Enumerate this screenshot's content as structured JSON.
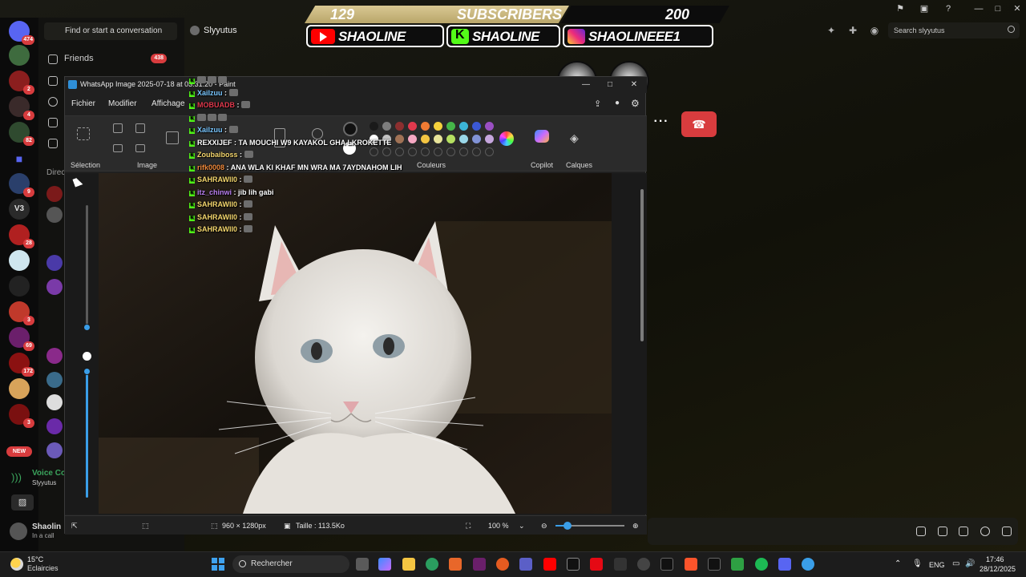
{
  "discord": {
    "dm_search_placeholder": "Find or start a conversation",
    "friends_label": "Friends",
    "friends_count": "438",
    "channel_name": "Slyyutus",
    "search_placeholder": "Search slyyutus",
    "guild_badges": [
      "474",
      "2",
      "4",
      "82",
      "9",
      "28",
      "3",
      "69",
      "172",
      "3"
    ],
    "new_label": "NEW",
    "voice_title": "Voice Co",
    "voice_sub": "Slyyutus",
    "user_name": "Shaolin",
    "user_status": "In a call",
    "v3_label": "V3",
    "direct_label": "Direc",
    "accent_red": "#d83c3e",
    "accent_green": "#3ba55d"
  },
  "paint": {
    "title": "WhatsApp Image 2025-07-18 at 03.31.20 - Paint",
    "menus": [
      "Fichier",
      "Modifier",
      "Affichage"
    ],
    "groups": {
      "selection": "Sélection",
      "image": "Image",
      "colors": "Couleurs",
      "copilot": "Copilot",
      "layers": "Calques"
    },
    "dimensions": "960 × 1280px",
    "size": "Taille : 113.5Ko",
    "zoom": "100 %",
    "palette": [
      "#1a1a1a",
      "#7d7d7d",
      "#8c2f2f",
      "#e0394d",
      "#f07b33",
      "#f5d13c",
      "#45b649",
      "#3cb5d8",
      "#3b58d4",
      "#9a4fc2",
      "#ffffff",
      "#c3c3c3",
      "#a07255",
      "#f6a8c3",
      "#f4c542",
      "#e8e49a",
      "#b5e061",
      "#9ad7e8",
      "#8193d6",
      "#c5a6dd"
    ]
  },
  "overlay": {
    "subscribers_current": "129",
    "subscribers_label": "SUBSCRIBERS",
    "subscribers_goal": "200",
    "youtube_handle": "SHAOLINE",
    "kick_handle": "SHAOLINE",
    "instagram_handle": "SHAOLINEEE1",
    "chat": [
      {
        "user": "",
        "text": "",
        "color": "#ffffff"
      },
      {
        "user": "XaiIzuu",
        "text": "",
        "color": "#7ac7ff"
      },
      {
        "user": "MOBUADB",
        "text": "",
        "color": "#e0394d"
      },
      {
        "user": "",
        "text": "",
        "color": "#e0394d"
      },
      {
        "user": "XaiIzuu",
        "text": "",
        "color": "#7ac7ff"
      },
      {
        "user": "REXXIJEF",
        "text": "TA MOUCHI W9 KAYAKOL GHA LKROKETTE",
        "color": "#ffffff"
      },
      {
        "user": "Zoubaiboss",
        "text": "",
        "color": "#f5d76e"
      },
      {
        "user": "rifk0008",
        "text": "ANA WLA KI KHAF MN WRA MA 7AYDNAHOM LIH",
        "color": "#f08a3c"
      },
      {
        "user": "SAHRAWII0",
        "text": "",
        "color": "#f5d76e"
      },
      {
        "user": "itz_chinwi",
        "text": "jib lih gabi",
        "color": "#b97ff0"
      },
      {
        "user": "SAHRAWII0",
        "text": "",
        "color": "#f5d76e"
      },
      {
        "user": "SAHRAWII0",
        "text": "",
        "color": "#f5d76e"
      },
      {
        "user": "SAHRAWII0",
        "text": "",
        "color": "#f5d76e"
      }
    ]
  },
  "taskbar": {
    "temperature": "15°C",
    "weather": "Eclaircies",
    "search_label": "Rechercher",
    "lang": "ENG",
    "time": "17:46",
    "date": "28/12/2025"
  }
}
